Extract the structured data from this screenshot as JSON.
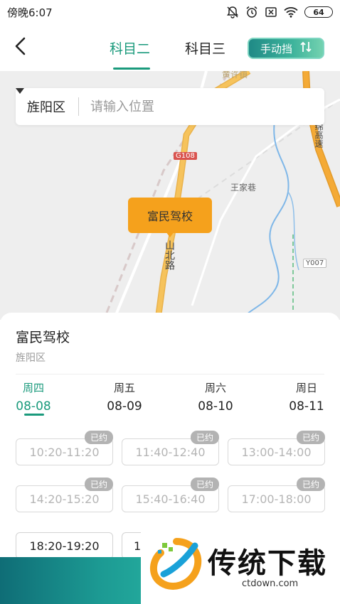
{
  "status_bar": {
    "time": "傍晚6:07",
    "battery": "64",
    "icons": [
      "mute-bell-icon",
      "alarm-icon",
      "sim-off-icon",
      "wifi-icon",
      "battery-icon"
    ]
  },
  "nav": {
    "back_icon": "chevron-left-icon",
    "tabs": [
      {
        "label": "科目二",
        "active": true
      },
      {
        "label": "科目三",
        "active": false
      }
    ],
    "gear_button": "手动挡",
    "gear_icon": "switch-arrows-icon",
    "accent_color": "#1a9a7c"
  },
  "search": {
    "district": "旌阳区",
    "placeholder": "请输入位置"
  },
  "map": {
    "labels": {
      "road_code_1": "G108",
      "village": "王家巷",
      "road_code_2": "Y007",
      "road_top": "黄许镇",
      "road_right": "绵高速",
      "road_vertical": "山北路"
    },
    "marker": "富民驾校",
    "marker_color": "#f5a11c"
  },
  "school": {
    "name": "富民驾校",
    "district": "旌阳区"
  },
  "days": [
    {
      "weekday": "周四",
      "date": "08-08",
      "active": true
    },
    {
      "weekday": "周五",
      "date": "08-09",
      "active": false
    },
    {
      "weekday": "周六",
      "date": "08-10",
      "active": false
    },
    {
      "weekday": "周日",
      "date": "08-11",
      "active": false
    }
  ],
  "slots": [
    {
      "time": "10:20-11:20",
      "badge": "已约"
    },
    {
      "time": "11:40-12:40",
      "badge": "已约"
    },
    {
      "time": "13:00-14:00",
      "badge": "已约"
    },
    {
      "time": "14:20-15:20",
      "badge": "已约"
    },
    {
      "time": "15:40-16:40",
      "badge": "已约"
    },
    {
      "time": "17:00-18:00",
      "badge": "已约"
    },
    {
      "time": "18:20-19:20",
      "badge": ""
    },
    {
      "time": "1",
      "badge": ""
    }
  ],
  "watermark": {
    "title": "传统下载",
    "url": "ctdown.com"
  }
}
